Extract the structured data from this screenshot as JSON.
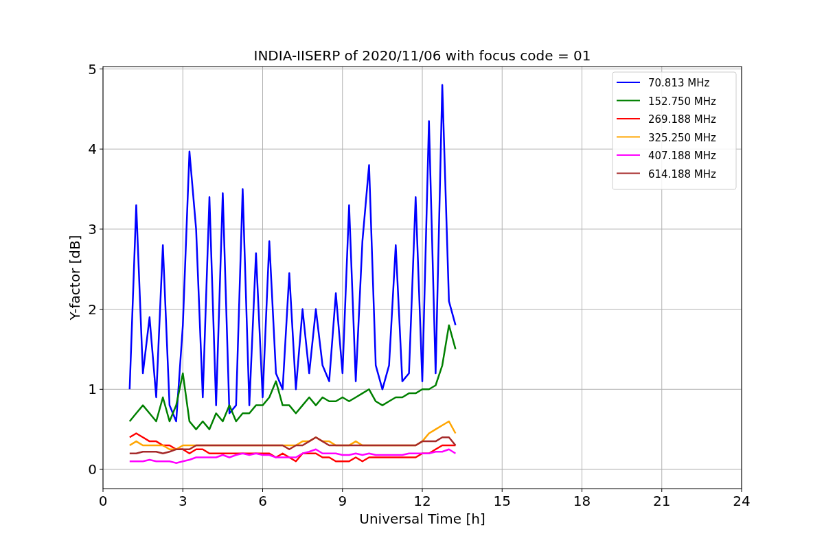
{
  "figure": {
    "chart_data": {
      "type": "line",
      "title": "INDIA-IISERP of 2020/11/06 with focus code = 01",
      "xlabel": "Universal Time [h]",
      "ylabel": "Y-factor [dB]",
      "x": [
        1,
        1.25,
        1.5,
        1.75,
        2,
        2.25,
        2.5,
        2.75,
        3,
        3.25,
        3.5,
        3.75,
        4,
        4.25,
        4.5,
        4.75,
        5,
        5.25,
        5.5,
        5.75,
        6,
        6.25,
        6.5,
        6.75,
        7,
        7.25,
        7.5,
        7.75,
        8,
        8.25,
        8.5,
        8.75,
        9,
        9.25,
        9.5,
        9.75,
        10,
        10.25,
        10.5,
        10.75,
        11,
        11.25,
        11.5,
        11.75,
        12,
        12.25,
        12.5,
        12.75,
        13,
        13.25
      ],
      "series": [
        {
          "name": "70.813 MHz",
          "color": "#0000ff",
          "values": [
            1.0,
            3.3,
            1.2,
            1.9,
            0.9,
            2.8,
            0.8,
            0.6,
            1.8,
            3.97,
            3.0,
            0.9,
            3.4,
            0.8,
            3.45,
            0.7,
            0.8,
            3.5,
            0.8,
            2.7,
            0.9,
            2.85,
            1.2,
            1.0,
            2.45,
            1.0,
            2.0,
            1.2,
            2.0,
            1.3,
            1.1,
            2.2,
            1.2,
            3.3,
            1.1,
            2.85,
            3.8,
            1.3,
            1.0,
            1.3,
            2.8,
            1.1,
            1.2,
            3.4,
            1.1,
            4.35,
            1.2,
            4.8,
            2.1,
            1.8
          ]
        },
        {
          "name": "152.750 MHz",
          "color": "#008000",
          "values": [
            0.6,
            0.7,
            0.8,
            0.7,
            0.6,
            0.9,
            0.6,
            0.8,
            1.2,
            0.6,
            0.5,
            0.6,
            0.5,
            0.7,
            0.6,
            0.8,
            0.6,
            0.7,
            0.7,
            0.8,
            0.8,
            0.9,
            1.1,
            0.8,
            0.8,
            0.7,
            0.8,
            0.9,
            0.8,
            0.9,
            0.85,
            0.85,
            0.9,
            0.85,
            0.9,
            0.95,
            1.0,
            0.85,
            0.8,
            0.85,
            0.9,
            0.9,
            0.95,
            0.95,
            1.0,
            1.0,
            1.05,
            1.3,
            1.8,
            1.5
          ]
        },
        {
          "name": "269.188 MHz",
          "color": "#ff0000",
          "values": [
            0.4,
            0.45,
            0.4,
            0.35,
            0.35,
            0.3,
            0.3,
            0.25,
            0.25,
            0.2,
            0.25,
            0.25,
            0.2,
            0.2,
            0.2,
            0.2,
            0.2,
            0.2,
            0.2,
            0.2,
            0.2,
            0.2,
            0.15,
            0.2,
            0.15,
            0.1,
            0.2,
            0.2,
            0.2,
            0.15,
            0.15,
            0.1,
            0.1,
            0.1,
            0.15,
            0.1,
            0.15,
            0.15,
            0.15,
            0.15,
            0.15,
            0.15,
            0.15,
            0.15,
            0.2,
            0.2,
            0.25,
            0.3,
            0.3,
            0.3
          ]
        },
        {
          "name": "325.250 MHz",
          "color": "#ffa500",
          "values": [
            0.3,
            0.35,
            0.3,
            0.3,
            0.3,
            0.3,
            0.25,
            0.25,
            0.3,
            0.3,
            0.3,
            0.3,
            0.3,
            0.3,
            0.3,
            0.3,
            0.3,
            0.3,
            0.3,
            0.3,
            0.3,
            0.3,
            0.3,
            0.3,
            0.3,
            0.3,
            0.35,
            0.35,
            0.4,
            0.35,
            0.35,
            0.3,
            0.3,
            0.3,
            0.35,
            0.3,
            0.3,
            0.3,
            0.3,
            0.3,
            0.3,
            0.3,
            0.3,
            0.3,
            0.35,
            0.45,
            0.5,
            0.55,
            0.6,
            0.45
          ]
        },
        {
          "name": "407.188 MHz",
          "color": "#ff00ff",
          "values": [
            0.1,
            0.1,
            0.1,
            0.12,
            0.1,
            0.1,
            0.1,
            0.08,
            0.1,
            0.12,
            0.15,
            0.15,
            0.15,
            0.15,
            0.18,
            0.15,
            0.18,
            0.2,
            0.18,
            0.2,
            0.18,
            0.18,
            0.15,
            0.15,
            0.15,
            0.15,
            0.2,
            0.22,
            0.25,
            0.2,
            0.2,
            0.2,
            0.18,
            0.18,
            0.2,
            0.18,
            0.2,
            0.18,
            0.18,
            0.18,
            0.18,
            0.18,
            0.2,
            0.2,
            0.2,
            0.2,
            0.22,
            0.22,
            0.25,
            0.2
          ]
        },
        {
          "name": "614.188 MHz",
          "color": "#a52a2a",
          "values": [
            0.2,
            0.2,
            0.22,
            0.22,
            0.22,
            0.2,
            0.22,
            0.25,
            0.25,
            0.25,
            0.3,
            0.3,
            0.3,
            0.3,
            0.3,
            0.3,
            0.3,
            0.3,
            0.3,
            0.3,
            0.3,
            0.3,
            0.3,
            0.3,
            0.25,
            0.3,
            0.3,
            0.35,
            0.4,
            0.35,
            0.3,
            0.3,
            0.3,
            0.3,
            0.3,
            0.3,
            0.3,
            0.3,
            0.3,
            0.3,
            0.3,
            0.3,
            0.3,
            0.3,
            0.35,
            0.35,
            0.35,
            0.4,
            0.4,
            0.3
          ]
        }
      ],
      "xlim": [
        0,
        24
      ],
      "ylim": [
        -0.24,
        5.03
      ],
      "xticks": [
        0,
        3,
        6,
        9,
        12,
        15,
        18,
        21,
        24
      ],
      "yticks": [
        0,
        1,
        2,
        3,
        4,
        5
      ],
      "grid": true,
      "legend": "upper right"
    }
  }
}
